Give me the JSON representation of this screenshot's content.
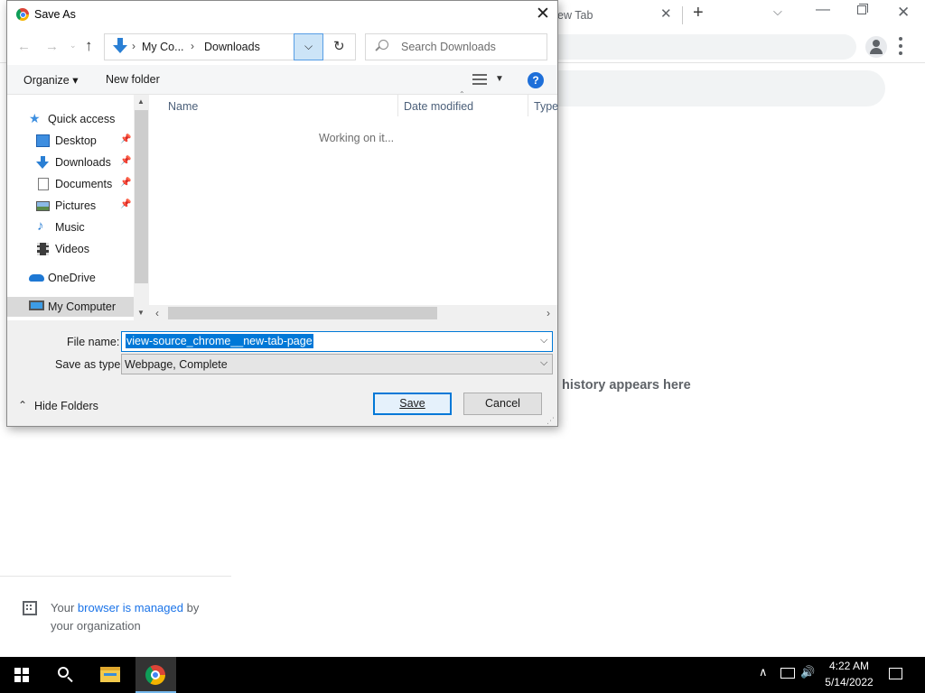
{
  "browser": {
    "tab_title": "New Tab",
    "tab_close": "✕",
    "new_tab": "+",
    "tab_search": "⌵",
    "window": {
      "minimize": "—",
      "close": "✕"
    },
    "empty_history_text": "Your history appears here",
    "empty_history_visible": "history appears here",
    "managed": {
      "prefix": "Your",
      "link": "browser is managed",
      "suffix": "by your organization"
    }
  },
  "dialog": {
    "title": "Save As",
    "close": "✕",
    "nav": {
      "back": "←",
      "forward": "→",
      "recent": "⌄",
      "up": "↑",
      "refresh": "↻"
    },
    "address": {
      "crumbs": [
        "My Co...",
        "Downloads"
      ],
      "chevron": "›",
      "dropdown": "⌵"
    },
    "search_placeholder": "Search Downloads",
    "toolbar": {
      "organize": "Organize ▾",
      "new_folder": "New folder",
      "view_dropdown": "▼",
      "help": "?"
    },
    "nav_tree": [
      {
        "label": "Quick access",
        "icon": "star-icon",
        "pinned": false
      },
      {
        "label": "Desktop",
        "icon": "desktop-folder-icon",
        "pinned": true
      },
      {
        "label": "Downloads",
        "icon": "downloads-arrow-icon",
        "pinned": true
      },
      {
        "label": "Documents",
        "icon": "documents-icon",
        "pinned": true
      },
      {
        "label": "Pictures",
        "icon": "pictures-icon",
        "pinned": true
      },
      {
        "label": "Music",
        "icon": "music-note-icon",
        "pinned": false
      },
      {
        "label": "Videos",
        "icon": "video-film-icon",
        "pinned": false
      },
      {
        "label": "OneDrive",
        "icon": "cloud-icon",
        "pinned": false
      },
      {
        "label": "My Computer",
        "icon": "computer-icon",
        "pinned": false
      }
    ],
    "pin_glyph": "📌",
    "columns": {
      "name": "Name",
      "date_modified": "Date modified",
      "type": "Type",
      "sort_caret": "⌃"
    },
    "status_text": "Working on it...",
    "scroll": {
      "up": "▲",
      "down": "▼",
      "left": "‹",
      "right": "›"
    },
    "file_name_label": "File name:",
    "file_name_value": "view-source_chrome__new-tab-page",
    "save_type_label": "Save as type:",
    "save_type_value": "Webpage, Complete",
    "field_dropdown": "⌵",
    "hide_folders": "Hide Folders",
    "hide_caret": "⌃",
    "save_button": "Save",
    "cancel_button": "Cancel",
    "grip": "⋰"
  },
  "taskbar": {
    "tray_up": "∧",
    "volume": "🔊",
    "time": "4:22 AM",
    "date": "5/14/2022"
  },
  "colors": {
    "accent": "#0078d7",
    "selection_bg": "#cce4f7",
    "taskbar": "#000000"
  }
}
